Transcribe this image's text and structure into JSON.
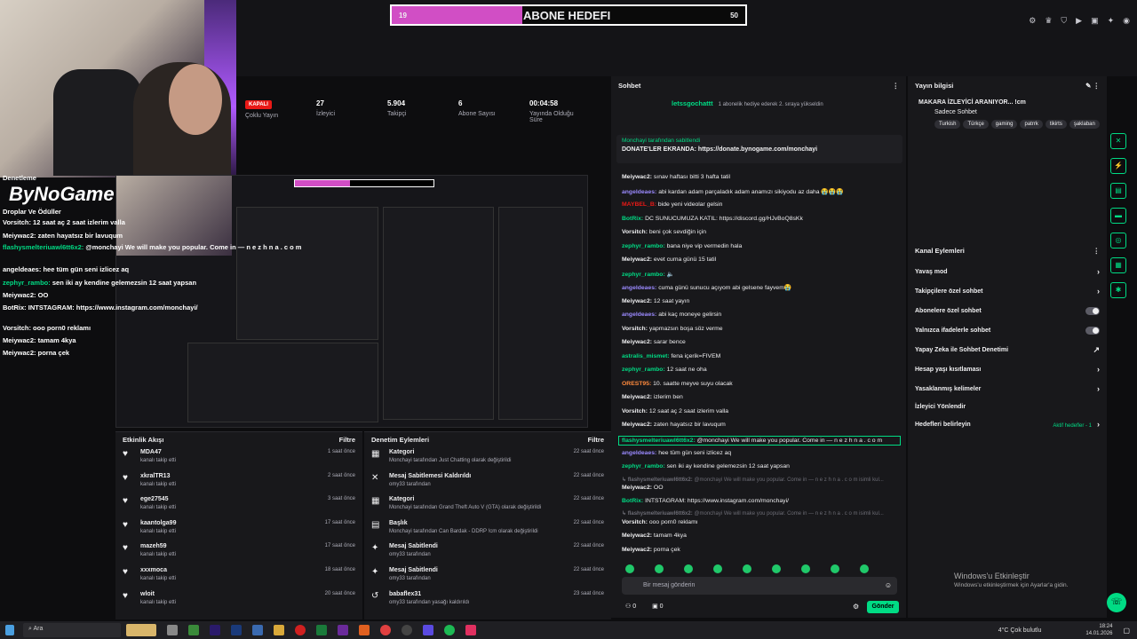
{
  "goal": {
    "left": "19",
    "title": "ABONE HEDEFI",
    "right": "50",
    "fill_fraction": 0.37
  },
  "stats": [
    {
      "value_badge": "KAPALI",
      "label": "Çoklu Yayın"
    },
    {
      "value": "27",
      "label": "İzleyici"
    },
    {
      "value": "5.904",
      "label": "Takipçi"
    },
    {
      "value": "6",
      "label": "Abone Sayısı"
    },
    {
      "value": "00:04:58",
      "label": "Yayında Olduğu Süre"
    }
  ],
  "overlay": {
    "brand": "ByNoGame",
    "lines": [
      {
        "user": "Denetleme",
        "text": ""
      },
      {
        "user": "Droplar Ve Ödüller",
        "text": ""
      },
      {
        "user": "Vorsitch:",
        "text": "12 saat aç 2 saat izlerim valla"
      },
      {
        "user": "Meiywac2:",
        "text": "zaten hayatsız bir lavuqum"
      },
      {
        "user": "flashysmelteriuawl6tt6x2:",
        "text": "@monchayi We will make you popular. Come in — n e z h n a . c o m"
      },
      {
        "user": "angeldeaes:",
        "text": "hee tüm gün seni izlicez aq"
      },
      {
        "user": "zephyr_rambo:",
        "text": "sen iki ay kendine gelemezsin 12 saat yapsan"
      },
      {
        "user": "Meiywac2:",
        "text": "OO"
      },
      {
        "user": "BotRix:",
        "text": "INTSTAGRAM: https://www.instagram.com/monchayi/"
      },
      {
        "user": "Vorsitch:",
        "text": "ooo porn0 reklamı"
      },
      {
        "user": "Meiywac2:",
        "text": "tamam 4kya"
      },
      {
        "user": "Meiywac2:",
        "text": "porna çek"
      }
    ]
  },
  "activity": {
    "title": "Etkinlik Akışı",
    "filter": "Filtre",
    "items": [
      {
        "name": "MDA47",
        "sub": "kanalı takip etti",
        "time": "1 saat önce"
      },
      {
        "name": "xkralTR13",
        "sub": "kanalı takip etti",
        "time": "2 saat önce"
      },
      {
        "name": "ege27545",
        "sub": "kanalı takip etti",
        "time": "3 saat önce"
      },
      {
        "name": "kaantolga99",
        "sub": "kanalı takip etti",
        "time": "17 saat önce"
      },
      {
        "name": "mazeh59",
        "sub": "kanalı takip etti",
        "time": "17 saat önce"
      },
      {
        "name": "xxxmoca",
        "sub": "kanalı takip etti",
        "time": "18 saat önce"
      },
      {
        "name": "wloit",
        "sub": "kanalı takip etti",
        "time": "20 saat önce"
      }
    ]
  },
  "moderation": {
    "title": "Denetim Eylemleri",
    "filter": "Filtre",
    "items": [
      {
        "name": "Kategori",
        "sub": "Monchayi tarafından Just Chatting olarak değiştirildi",
        "time": "22 saat önce"
      },
      {
        "name": "Mesaj Sabitlemesi Kaldırıldı",
        "sub": "omy33 tarafından",
        "time": "22 saat önce"
      },
      {
        "name": "Kategori",
        "sub": "Monchayi tarafından Grand Theft Auto V (GTA) olarak değiştirildi",
        "time": "22 saat önce"
      },
      {
        "name": "Başlık",
        "sub": "Monchayi tarafından Can Bardak - DDRP !cm olarak değiştirildi",
        "time": "22 saat önce"
      },
      {
        "name": "Mesaj Sabitlendi",
        "sub": "omy33 tarafından",
        "time": "22 saat önce"
      },
      {
        "name": "Mesaj Sabitlendi",
        "sub": "omy33 tarafından",
        "time": "22 saat önce"
      },
      {
        "name": "babaflex31",
        "sub": "omy33 tarafından yasağı kaldırıldı",
        "time": "23 saat önce"
      }
    ]
  },
  "chat": {
    "title": "Sohbet",
    "gifter": "letssgochattt",
    "gift_text": "1 abonelik hediye ederek 2. sıraya yükseldin",
    "pinned_by": "Monchayi tarafından sabitlendi",
    "pinned_text": "DONATE'LER EKRANDA: https://donate.bynogame.com/monchayi",
    "messages": [
      {
        "user": "Meiywac2:",
        "text": "sınav haftası bitti 3 hafta tatil",
        "color": "#efeff1"
      },
      {
        "user": "angeldeaes:",
        "text": "abi kardan adam parçaladık adam anamızı sikiyodu az daha 😭😭😭",
        "color": "#9b8aff"
      },
      {
        "user": "MAYBEL_B:",
        "text": "bide yeni videolar gelsin",
        "color": "#e91916"
      },
      {
        "user": "BotRix:",
        "text": "DC SUNUCUMUZA KATIL: https://discord.gg/HJvBoQ8sKk",
        "color": "#00db84"
      },
      {
        "user": "Vorsitch:",
        "text": "beni çok sevdiğin için",
        "color": "#efeff1"
      },
      {
        "user": "zephyr_rambo:",
        "text": "bana niye vip vermedin hala",
        "color": "#00db84"
      },
      {
        "user": "Meiywac2:",
        "text": "evet cuma günü 15 tatil",
        "color": "#efeff1"
      },
      {
        "user": "zephyr_rambo:",
        "text": "🔈",
        "color": "#00db84"
      },
      {
        "user": "angeldeaes:",
        "text": "cuma günü sunucu açıyom abi gelsene fayvem😭",
        "color": "#9b8aff"
      },
      {
        "user": "Meiywac2:",
        "text": "12 saat yayın",
        "color": "#efeff1"
      },
      {
        "user": "angeldeaes:",
        "text": "abi kaç moneye gelirsin",
        "color": "#9b8aff"
      },
      {
        "user": "Vorsitch:",
        "text": "yapmazsın boşa söz verme",
        "color": "#efeff1"
      },
      {
        "user": "Meiywac2:",
        "text": "sarar bence",
        "color": "#efeff1"
      },
      {
        "user": "astralis_mismet:",
        "text": "fena içerik=FIVEM",
        "color": "#00db84"
      },
      {
        "user": "zephyr_rambo:",
        "text": "12 saat ne oha",
        "color": "#00db84"
      },
      {
        "user": "OREST95:",
        "text": "10. saatte meyve suyu olacak",
        "color": "#ff8a3d"
      },
      {
        "user": "Meiywac2:",
        "text": "izlerim ben",
        "color": "#efeff1"
      },
      {
        "user": "Vorsitch:",
        "text": "12 saat aç 2 saat izlerim valla",
        "color": "#efeff1"
      },
      {
        "user": "Meiywac2:",
        "text": "zaten hayatsız bir lavuqum",
        "color": "#efeff1"
      },
      {
        "user": "flashysmelteriuawl6tt6x2:",
        "text": "@monchayi We will make you popular. Come in — n e z h n a . c o m",
        "color": "#00db84"
      },
      {
        "user": "angeldeaes:",
        "text": "hee tüm gün seni izlicez aq",
        "color": "#9b8aff"
      },
      {
        "user": "zephyr_rambo:",
        "text": "sen iki ay kendine gelemezsin 12 saat yapsan",
        "color": "#00db84"
      },
      {
        "user": "↳ flashysmelteriuawl6tt6x2:",
        "text": "@monchayi We will make you popular. Come in — n e z h n a . c o m isimli kul...",
        "color": "#6c6c75"
      },
      {
        "user": "Meiywac2:",
        "text": "OO",
        "color": "#efeff1"
      },
      {
        "user": "BotRix:",
        "text": "INTSTAGRAM: https://www.instagram.com/monchayi/",
        "color": "#00db84"
      },
      {
        "user": "↳ flashysmelteriuawl6tt6x2:",
        "text": "@monchayi We will make you popular. Come in — n e z h n a . c o m isimli kul...",
        "color": "#6c6c75"
      },
      {
        "user": "Vorsitch:",
        "text": "ooo porn0 reklamı",
        "color": "#efeff1"
      },
      {
        "user": "Meiywac2:",
        "text": "tamam 4kya",
        "color": "#efeff1"
      },
      {
        "user": "Meiywac2:",
        "text": "porna çek",
        "color": "#efeff1"
      }
    ],
    "input_placeholder": "Bir mesaj gönderin",
    "viewer_count": "0",
    "gift_count": "0",
    "send_label": "Gönder"
  },
  "stream_info": {
    "title": "Yayın bilgisi",
    "stream_title": "MAKARA İZLEYİCİ ARANIYOR... !cm",
    "category": "Sadece Sohbet",
    "tags": [
      "Turkish",
      "Türkçe",
      "gaming",
      "patrrk",
      "tikirts",
      "şaklaban"
    ]
  },
  "channel_actions": {
    "title": "Kanal Eylemleri",
    "items": [
      {
        "label": "Yavaş mod",
        "control": "›"
      },
      {
        "label": "Takipçilere özel sohbet",
        "control": "›"
      },
      {
        "label": "Abonelere özel sohbet",
        "control": "toggle"
      },
      {
        "label": "Yalnızca ifadelerle sohbet",
        "control": "toggle"
      },
      {
        "label": "Yapay Zeka ile Sohbet Denetimi",
        "control": "↗"
      },
      {
        "label": "Hesap yaşı kısıtlaması",
        "control": "›"
      },
      {
        "label": "Yasaklanmış kelimeler",
        "control": "›"
      },
      {
        "label": "İzleyici Yönlendir",
        "control": ""
      },
      {
        "label": "Hedefleri belirleyin",
        "control": "›",
        "extra": "Aktif hedefler - 1"
      }
    ]
  },
  "windows": {
    "activate_title": "Windows'u Etkinleştir",
    "activate_sub": "Windows'u etkinleştirmek için Ayarlar'a gidin."
  },
  "taskbar": {
    "search": "Ara",
    "weather": "4°C  Çok bulutlu",
    "time": "18:24",
    "date": "14.01.2026"
  }
}
